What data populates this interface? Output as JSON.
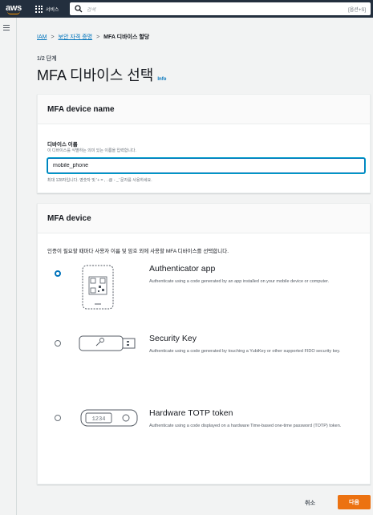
{
  "topnav": {
    "logo_text": "aws",
    "services_label": "서비스",
    "search_placeholder": "검색",
    "search_shortcut": "[옵션+S]"
  },
  "breadcrumb": {
    "items": [
      "IAM",
      "보안 자격 증명",
      "MFA 디바이스 할당"
    ],
    "separator": ">"
  },
  "step": "1/2 단계",
  "page_title": "MFA 디바이스 선택",
  "info_label": "Info",
  "name_panel": {
    "title": "MFA device name",
    "field_label": "디바이스 이름",
    "field_description": "이 디바이스를 식별하는 의미 있는 이름을 입력합니다.",
    "field_value": "mobile_phone",
    "field_constraint": "최대 128자입니다. 영숫자 및 '+ = , . @ - _' 문자를 사용하세요."
  },
  "device_panel": {
    "title": "MFA device",
    "intro": "인증이 필요할 때마다 사용자 이름 및 암호 외에 사용할 MFA 디바이스를 선택합니다.",
    "options": [
      {
        "title": "Authenticator app",
        "description": "Authenticate using a code generated by an app installed on your mobile device or computer.",
        "selected": true,
        "icon": "phone-qr-icon"
      },
      {
        "title": "Security Key",
        "description": "Authenticate using a code generated by touching a YubiKey or other supported FIDO security key.",
        "selected": false,
        "icon": "security-key-icon"
      },
      {
        "title": "Hardware TOTP token",
        "description": "Authenticate using a code displayed on a hardware Time-based one-time password (TOTP) token.",
        "selected": false,
        "icon": "totp-token-icon",
        "token_display": "1234"
      }
    ]
  },
  "footer": {
    "cancel_label": "취소",
    "next_label": "다음"
  },
  "colors": {
    "nav_bg": "#232f3e",
    "accent_orange": "#ec7211",
    "link_blue": "#0073bb",
    "page_bg": "#f2f3f3"
  }
}
